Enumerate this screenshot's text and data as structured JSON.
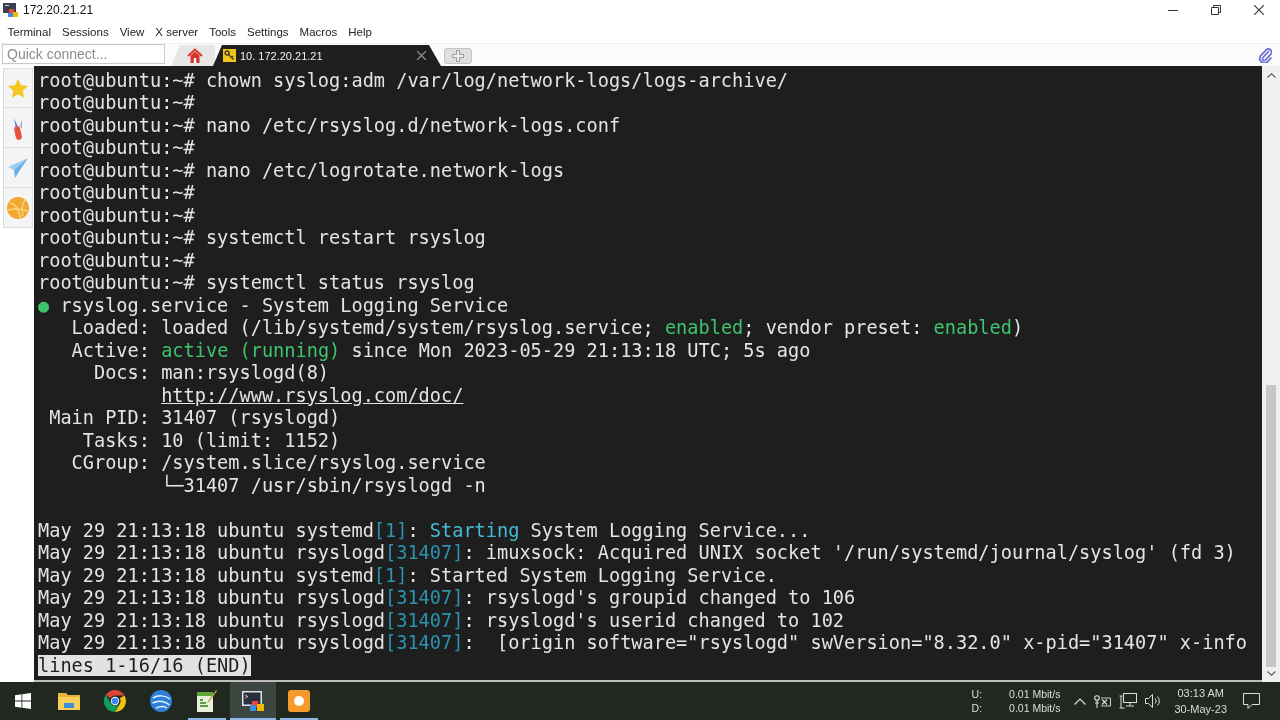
{
  "window": {
    "title": "172.20.21.21"
  },
  "menu": [
    "Terminal",
    "Sessions",
    "View",
    "X server",
    "Tools",
    "Settings",
    "Macros",
    "Help"
  ],
  "quick_connect": {
    "placeholder": "Quick connect..."
  },
  "tabs": [
    {
      "kind": "home",
      "selected": false
    },
    {
      "kind": "session",
      "label": "10. 172.20.21.21",
      "selected": true
    }
  ],
  "terminal": {
    "blocks": [
      [
        [
          {
            "kind": "plain",
            "text": "root@ubuntu:~# chown syslog:adm /var/log/network-logs/logs-archive/"
          }
        ],
        [
          {
            "kind": "plain",
            "text": "root@ubuntu:~#"
          }
        ],
        [
          {
            "kind": "plain",
            "text": "root@ubuntu:~# nano /etc/rsyslog.d/network-logs.conf"
          }
        ],
        [
          {
            "kind": "plain",
            "text": "root@ubuntu:~#"
          }
        ],
        [
          {
            "kind": "plain",
            "text": "root@ubuntu:~# nano /etc/logrotate.network-logs"
          }
        ],
        [
          {
            "kind": "plain",
            "text": "root@ubuntu:~#"
          }
        ],
        [
          {
            "kind": "plain",
            "text": "root@ubuntu:~#"
          }
        ],
        [
          {
            "kind": "plain",
            "text": "root@ubuntu:~# systemctl restart rsyslog"
          }
        ],
        [
          {
            "kind": "plain",
            "text": "root@ubuntu:~#"
          }
        ],
        [
          {
            "kind": "plain",
            "text": "root@ubuntu:~# systemctl status rsyslog"
          }
        ],
        [
          {
            "kind": "ok",
            "text": "●"
          },
          {
            "kind": "plain",
            "text": " rsyslog.service - System Logging Service"
          }
        ],
        [
          {
            "kind": "plain",
            "text": "   Loaded: loaded (/lib/systemd/system/rsyslog.service; "
          },
          {
            "kind": "ok",
            "text": "enabled"
          },
          {
            "kind": "plain",
            "text": "; vendor preset: "
          },
          {
            "kind": "ok",
            "text": "enabled"
          },
          {
            "kind": "plain",
            "text": ")"
          }
        ],
        [
          {
            "kind": "plain",
            "text": "   Active: "
          },
          {
            "kind": "ok",
            "text": "active (running)"
          },
          {
            "kind": "plain",
            "text": " since Mon 2023-05-29 21:13:18 UTC; 5s ago"
          }
        ],
        [
          {
            "kind": "plain",
            "text": "     Docs: man:rsyslogd(8)"
          }
        ],
        [
          {
            "kind": "link",
            "text": "           http://www.rsyslog.com/doc/"
          }
        ],
        [
          {
            "kind": "plain",
            "text": " Main PID: 31407 (rsyslogd)"
          }
        ],
        [
          {
            "kind": "plain",
            "text": "    Tasks: 10 (limit: 1152)"
          }
        ],
        [
          {
            "kind": "plain",
            "text": "   CGroup: /system.slice/rsyslog.service"
          }
        ],
        [
          {
            "kind": "plain",
            "text": "           └─31407 /usr/sbin/rsyslogd -n"
          }
        ]
      ],
      [
        [
          {
            "kind": "plain",
            "text": "May 29 21:13:18 ubuntu systemd"
          },
          {
            "kind": "pid",
            "text": "[1]"
          },
          {
            "kind": "plain",
            "text": ": "
          },
          {
            "kind": "highlight",
            "text": "Starting"
          },
          {
            "kind": "plain",
            "text": " System Logging Service..."
          }
        ],
        [
          {
            "kind": "plain",
            "text": "May 29 21:13:18 ubuntu rsyslogd"
          },
          {
            "kind": "pid",
            "text": "[31407]"
          },
          {
            "kind": "plain",
            "text": ": imuxsock: Acquired UNIX socket '/run/systemd/journal/syslog' (fd 3)"
          }
        ],
        [
          {
            "kind": "plain",
            "text": "May 29 21:13:18 ubuntu systemd"
          },
          {
            "kind": "pid",
            "text": "[1]"
          },
          {
            "kind": "plain",
            "text": ": Started System Logging Service."
          }
        ],
        [
          {
            "kind": "plain",
            "text": "May 29 21:13:18 ubuntu rsyslogd"
          },
          {
            "kind": "pid",
            "text": "[31407]"
          },
          {
            "kind": "plain",
            "text": ": rsyslogd's groupid changed to 106"
          }
        ],
        [
          {
            "kind": "plain",
            "text": "May 29 21:13:18 ubuntu rsyslogd"
          },
          {
            "kind": "pid",
            "text": "[31407]"
          },
          {
            "kind": "plain",
            "text": ": rsyslogd's userid changed to 102"
          }
        ],
        [
          {
            "kind": "plain",
            "text": "May 29 21:13:18 ubuntu rsyslogd"
          },
          {
            "kind": "pid",
            "text": "[31407]"
          },
          {
            "kind": "plain",
            "text": ":  [origin software=\"rsyslogd\" swVersion=\"8.32.0\" x-pid=\"31407\" x-info"
          }
        ]
      ]
    ],
    "pager_status": "lines 1-16/16 (END)"
  },
  "taskbar": {
    "apps": [
      {
        "running": false,
        "selected": false
      },
      {
        "running": false,
        "selected": false
      },
      {
        "running": false,
        "selected": false
      },
      {
        "running": true,
        "selected": false
      },
      {
        "running": true,
        "selected": true
      },
      {
        "running": true,
        "selected": false
      }
    ],
    "tray": {
      "upload_label": "U:",
      "download_label": "D:",
      "upload_rate": "0.01 Mbit/s",
      "download_rate": "0.01 Mbit/s",
      "time": "03:13 AM",
      "date": "30-May-23"
    }
  }
}
